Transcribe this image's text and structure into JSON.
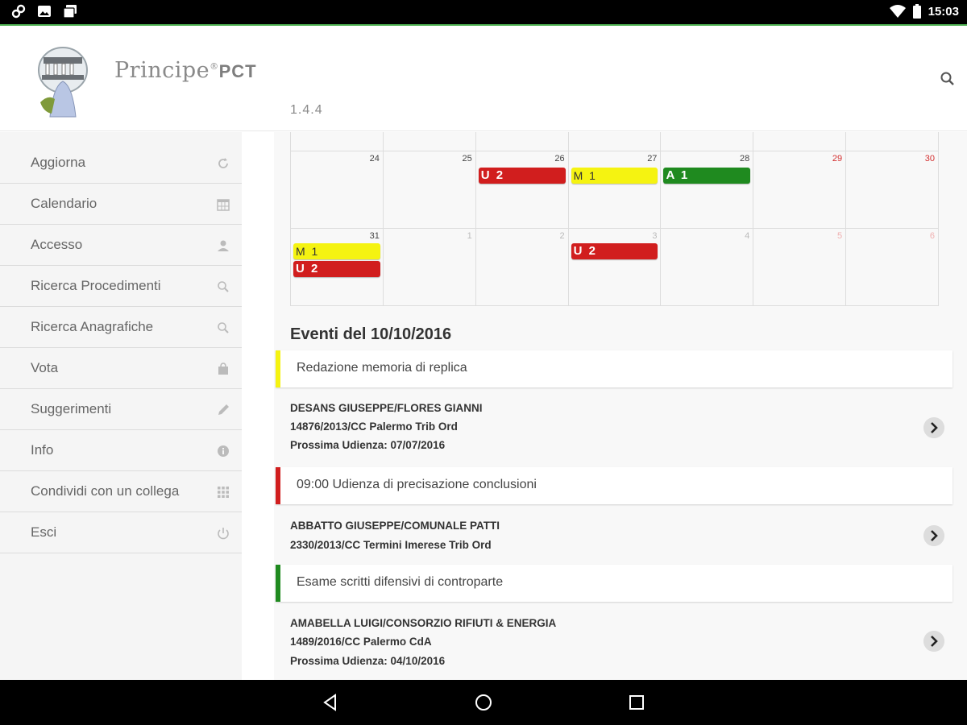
{
  "status_bar": {
    "time": "15:03"
  },
  "header": {
    "brand_name": "Principe",
    "brand_reg": "®",
    "brand_suffix": "PCT",
    "version": "1.4.4"
  },
  "sidebar": {
    "items": [
      {
        "label": "Aggiorna",
        "icon": "refresh-icon"
      },
      {
        "label": "Calendario",
        "icon": "calendar-icon"
      },
      {
        "label": "Accesso",
        "icon": "user-icon"
      },
      {
        "label": "Ricerca Procedimenti",
        "icon": "search-icon"
      },
      {
        "label": "Ricerca Anagrafiche",
        "icon": "search-icon"
      },
      {
        "label": "Vota",
        "icon": "shopping-bag-icon"
      },
      {
        "label": "Suggerimenti",
        "icon": "pencil-icon"
      },
      {
        "label": "Info",
        "icon": "info-icon"
      },
      {
        "label": "Condividi con un collega",
        "icon": "grid-icon"
      },
      {
        "label": "Esci",
        "icon": "power-icon"
      }
    ]
  },
  "calendar": {
    "week1": {
      "days": [
        "24",
        "25",
        "26",
        "27",
        "28",
        "29",
        "30"
      ],
      "events": {
        "26": "U 2",
        "27": "M 1",
        "28": "A 1"
      }
    },
    "week2": {
      "days": [
        "31",
        "1",
        "2",
        "3",
        "4",
        "5",
        "6"
      ],
      "events_31": [
        "M 1",
        "U 2"
      ],
      "event_3": "U 2"
    }
  },
  "events": {
    "title": "Eventi del 10/10/2016",
    "list": [
      {
        "text": "Redazione memoria di replica",
        "color": "#f5f311",
        "case_lines": [
          "DESANS GIUSEPPE/FLORES GIANNI",
          "14876/2013/CC Palermo Trib Ord",
          "Prossima Udienza: 07/07/2016"
        ]
      },
      {
        "text": "09:00 Udienza di precisazione conclusioni",
        "color": "#d11e1e",
        "case_lines": [
          "ABBATTO GIUSEPPE/COMUNALE PATTI",
          "2330/2013/CC Termini Imerese Trib Ord"
        ]
      },
      {
        "text": "Esame scritti difensivi di controparte",
        "color": "#1f8a1f",
        "case_lines": [
          "AMABELLA LUIGI/CONSORZIO RIFIUTI & ENERGIA",
          "1489/2016/CC Palermo CdA",
          "Prossima Udienza: 04/10/2016"
        ]
      }
    ]
  },
  "colors": {
    "accent_green": "#4caf50",
    "event_red": "#d11e1e",
    "event_yellow": "#f5f311",
    "event_green": "#1f8a1f"
  }
}
